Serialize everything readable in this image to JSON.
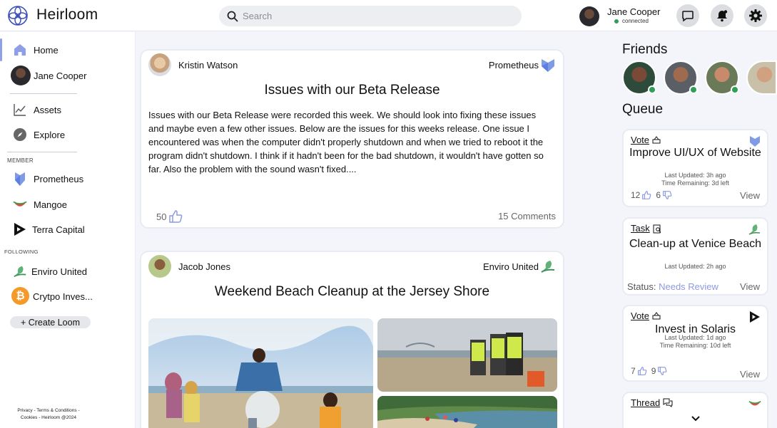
{
  "app": {
    "name": "Heirloom"
  },
  "search": {
    "placeholder": "Search"
  },
  "user": {
    "name": "Jane Cooper",
    "status": "connected"
  },
  "header_icons": [
    "chat-icon",
    "bell-icon",
    "gear-icon"
  ],
  "sidebar": {
    "nav": [
      {
        "label": "Home",
        "icon": "home-icon"
      },
      {
        "label": "Jane Cooper",
        "icon": "avatar"
      }
    ],
    "tools": [
      {
        "label": "Assets",
        "icon": "chart-icon"
      },
      {
        "label": "Explore",
        "icon": "compass-icon"
      }
    ],
    "member_label": "MEMBER",
    "member": [
      {
        "label": "Prometheus",
        "icon": "prometheus-logo"
      },
      {
        "label": "Mangoe",
        "icon": "mangoe-logo"
      },
      {
        "label": "Terra Capital",
        "icon": "terra-capital-logo"
      }
    ],
    "following_label": "FOLLOWING",
    "following": [
      {
        "label": "Enviro United",
        "icon": "enviro-united-logo"
      },
      {
        "label": "Crytpo Inves...",
        "icon": "bitcoin-logo"
      }
    ],
    "create_label": "+ Create Loom",
    "footer": "Privacy - Terms & Conditions - Cookies - Heirloom @2024"
  },
  "posts": [
    {
      "author": "Kristin Watson",
      "loom": "Prometheus",
      "title": "Issues with our Beta Release",
      "body": "Issues with our Beta Release were recorded this week. We should look into fixing these issues and maybe even a few other issues. Below are the issues for this weeks release. One issue I encountered was when the computer didn't properly shutdown and when we tried to reboot it the program didn't shutdown. I think if it hadn't been for the bad shutdown, it wouldn't have gotten so far. Also the problem with the sound wasn't fixed....",
      "likes": "50",
      "comments": "15 Comments"
    },
    {
      "author": "Jacob Jones",
      "loom": "Enviro United",
      "title": "Weekend Beach Cleanup at the Jersey Shore"
    }
  ],
  "right": {
    "friends_title": "Friends",
    "queue_title": "Queue",
    "queue": [
      {
        "type": "Vote",
        "title": "Improve UI/UX of Website",
        "updated": "Last Updated: 3h ago",
        "remaining": "Time Remaining: 3d left",
        "up": "12",
        "down": "6",
        "view": "View"
      },
      {
        "type": "Task",
        "title": "Clean-up at Venice Beach",
        "updated": "Last Updated: 2h ago",
        "status_label": "Status:",
        "status_value": "Needs Review",
        "view": "View"
      },
      {
        "type": "Vote",
        "title": "Invest in Solaris",
        "updated": "Last Updated: 1d ago",
        "remaining": "Time Remaining: 10d left",
        "up": "7",
        "down": "9",
        "view": "View"
      },
      {
        "type": "Thread"
      }
    ]
  },
  "colors": {
    "accent": "#8c9be0",
    "online": "#2f9e57",
    "logo": "#3b4fb8"
  }
}
